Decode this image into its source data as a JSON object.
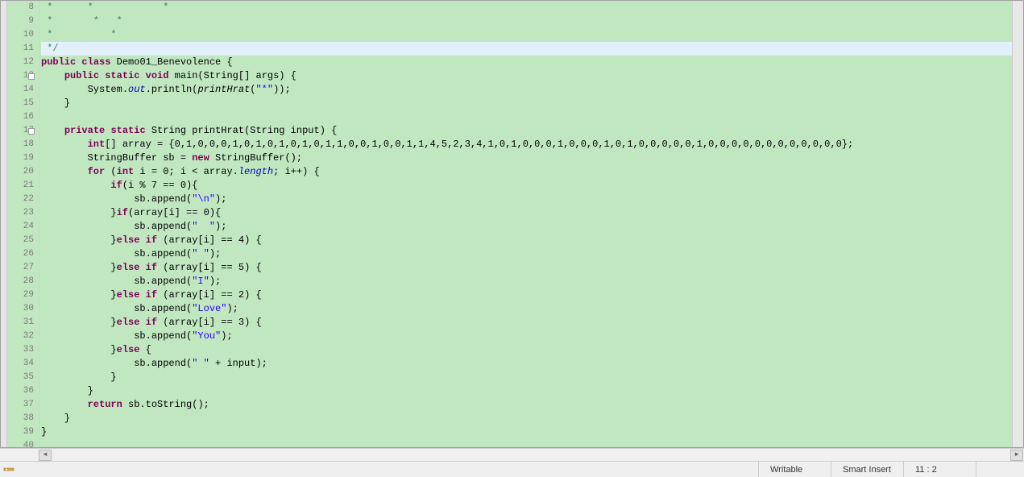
{
  "status": {
    "writable": "Writable",
    "insertMode": "Smart Insert",
    "cursor": "11 : 2"
  },
  "editor": {
    "currentLine": 11,
    "lines": [
      {
        "n": 8,
        "tokens": [
          {
            "t": "com",
            "v": " *      *            *"
          }
        ]
      },
      {
        "n": 9,
        "tokens": [
          {
            "t": "com",
            "v": " *       *   *"
          }
        ]
      },
      {
        "n": 10,
        "tokens": [
          {
            "t": "com",
            "v": " *          *"
          }
        ]
      },
      {
        "n": 11,
        "tokens": [
          {
            "t": "com",
            "v": " */"
          }
        ]
      },
      {
        "n": 12,
        "tokens": [
          {
            "t": "kw",
            "v": "public"
          },
          {
            "t": "",
            "v": " "
          },
          {
            "t": "kw",
            "v": "class"
          },
          {
            "t": "",
            "v": " Demo01_Benevolence {"
          }
        ]
      },
      {
        "n": 13,
        "fold": true,
        "tokens": [
          {
            "t": "",
            "v": "    "
          },
          {
            "t": "kw",
            "v": "public"
          },
          {
            "t": "",
            "v": " "
          },
          {
            "t": "kw",
            "v": "static"
          },
          {
            "t": "",
            "v": " "
          },
          {
            "t": "kw",
            "v": "void"
          },
          {
            "t": "",
            "v": " main(String[] args) {"
          }
        ]
      },
      {
        "n": 14,
        "tokens": [
          {
            "t": "",
            "v": "        System."
          },
          {
            "t": "field",
            "v": "out"
          },
          {
            "t": "",
            "v": ".println("
          },
          {
            "t": "call-it",
            "v": "printHrat"
          },
          {
            "t": "",
            "v": "("
          },
          {
            "t": "str",
            "v": "\"*\""
          },
          {
            "t": "",
            "v": "));"
          }
        ]
      },
      {
        "n": 15,
        "tokens": [
          {
            "t": "",
            "v": "    }"
          }
        ]
      },
      {
        "n": 16,
        "tokens": [
          {
            "t": "",
            "v": ""
          }
        ]
      },
      {
        "n": 17,
        "fold": true,
        "tokens": [
          {
            "t": "",
            "v": "    "
          },
          {
            "t": "kw",
            "v": "private"
          },
          {
            "t": "",
            "v": " "
          },
          {
            "t": "kw",
            "v": "static"
          },
          {
            "t": "",
            "v": " String printHrat(String input) {"
          }
        ]
      },
      {
        "n": 18,
        "tokens": [
          {
            "t": "",
            "v": "        "
          },
          {
            "t": "kw",
            "v": "int"
          },
          {
            "t": "",
            "v": "[] array = {0,1,0,0,0,1,0,1,0,1,0,1,0,1,1,0,0,1,0,0,1,1,4,5,2,3,4,1,0,1,0,0,0,1,0,0,0,1,0,1,0,0,0,0,0,1,0,0,0,0,0,0,0,0,0,0,0,0};"
          }
        ]
      },
      {
        "n": 19,
        "tokens": [
          {
            "t": "",
            "v": "        StringBuffer sb = "
          },
          {
            "t": "kw",
            "v": "new"
          },
          {
            "t": "",
            "v": " StringBuffer();"
          }
        ]
      },
      {
        "n": 20,
        "tokens": [
          {
            "t": "",
            "v": "        "
          },
          {
            "t": "kw",
            "v": "for"
          },
          {
            "t": "",
            "v": " ("
          },
          {
            "t": "kw",
            "v": "int"
          },
          {
            "t": "",
            "v": " i = 0; i < array."
          },
          {
            "t": "field",
            "v": "length"
          },
          {
            "t": "",
            "v": "; i++) {"
          }
        ]
      },
      {
        "n": 21,
        "tokens": [
          {
            "t": "",
            "v": "            "
          },
          {
            "t": "kw",
            "v": "if"
          },
          {
            "t": "",
            "v": "(i % 7 == 0){"
          }
        ]
      },
      {
        "n": 22,
        "tokens": [
          {
            "t": "",
            "v": "                sb.append("
          },
          {
            "t": "str",
            "v": "\"\\n\""
          },
          {
            "t": "",
            "v": ");"
          }
        ]
      },
      {
        "n": 23,
        "tokens": [
          {
            "t": "",
            "v": "            }"
          },
          {
            "t": "kw",
            "v": "if"
          },
          {
            "t": "",
            "v": "(array[i] == 0){"
          }
        ]
      },
      {
        "n": 24,
        "tokens": [
          {
            "t": "",
            "v": "                sb.append("
          },
          {
            "t": "str",
            "v": "\"  \""
          },
          {
            "t": "",
            "v": ");"
          }
        ]
      },
      {
        "n": 25,
        "tokens": [
          {
            "t": "",
            "v": "            }"
          },
          {
            "t": "kw",
            "v": "else"
          },
          {
            "t": "",
            "v": " "
          },
          {
            "t": "kw",
            "v": "if"
          },
          {
            "t": "",
            "v": " (array[i] == 4) {"
          }
        ]
      },
      {
        "n": 26,
        "tokens": [
          {
            "t": "",
            "v": "                sb.append("
          },
          {
            "t": "str",
            "v": "\" \""
          },
          {
            "t": "",
            "v": ");"
          }
        ]
      },
      {
        "n": 27,
        "tokens": [
          {
            "t": "",
            "v": "            }"
          },
          {
            "t": "kw",
            "v": "else"
          },
          {
            "t": "",
            "v": " "
          },
          {
            "t": "kw",
            "v": "if"
          },
          {
            "t": "",
            "v": " (array[i] == 5) {"
          }
        ]
      },
      {
        "n": 28,
        "tokens": [
          {
            "t": "",
            "v": "                sb.append("
          },
          {
            "t": "str",
            "v": "\"I\""
          },
          {
            "t": "",
            "v": ");"
          }
        ]
      },
      {
        "n": 29,
        "tokens": [
          {
            "t": "",
            "v": "            }"
          },
          {
            "t": "kw",
            "v": "else"
          },
          {
            "t": "",
            "v": " "
          },
          {
            "t": "kw",
            "v": "if"
          },
          {
            "t": "",
            "v": " (array[i] == 2) {"
          }
        ]
      },
      {
        "n": 30,
        "tokens": [
          {
            "t": "",
            "v": "                sb.append("
          },
          {
            "t": "str",
            "v": "\"Love\""
          },
          {
            "t": "",
            "v": ");"
          }
        ]
      },
      {
        "n": 31,
        "tokens": [
          {
            "t": "",
            "v": "            }"
          },
          {
            "t": "kw",
            "v": "else"
          },
          {
            "t": "",
            "v": " "
          },
          {
            "t": "kw",
            "v": "if"
          },
          {
            "t": "",
            "v": " (array[i] == 3) {"
          }
        ]
      },
      {
        "n": 32,
        "tokens": [
          {
            "t": "",
            "v": "                sb.append("
          },
          {
            "t": "str",
            "v": "\"You\""
          },
          {
            "t": "",
            "v": ");"
          }
        ]
      },
      {
        "n": 33,
        "tokens": [
          {
            "t": "",
            "v": "            }"
          },
          {
            "t": "kw",
            "v": "else"
          },
          {
            "t": "",
            "v": " {"
          }
        ]
      },
      {
        "n": 34,
        "tokens": [
          {
            "t": "",
            "v": "                sb.append("
          },
          {
            "t": "str",
            "v": "\" \""
          },
          {
            "t": "",
            "v": " + input);"
          }
        ]
      },
      {
        "n": 35,
        "tokens": [
          {
            "t": "",
            "v": "            }"
          }
        ]
      },
      {
        "n": 36,
        "tokens": [
          {
            "t": "",
            "v": "        }"
          }
        ]
      },
      {
        "n": 37,
        "tokens": [
          {
            "t": "",
            "v": "        "
          },
          {
            "t": "kw",
            "v": "return"
          },
          {
            "t": "",
            "v": " sb.toString();"
          }
        ]
      },
      {
        "n": 38,
        "tokens": [
          {
            "t": "",
            "v": "    }"
          }
        ]
      },
      {
        "n": 39,
        "tokens": [
          {
            "t": "",
            "v": "}"
          }
        ]
      },
      {
        "n": 40,
        "tokens": [
          {
            "t": "",
            "v": ""
          }
        ]
      }
    ]
  }
}
